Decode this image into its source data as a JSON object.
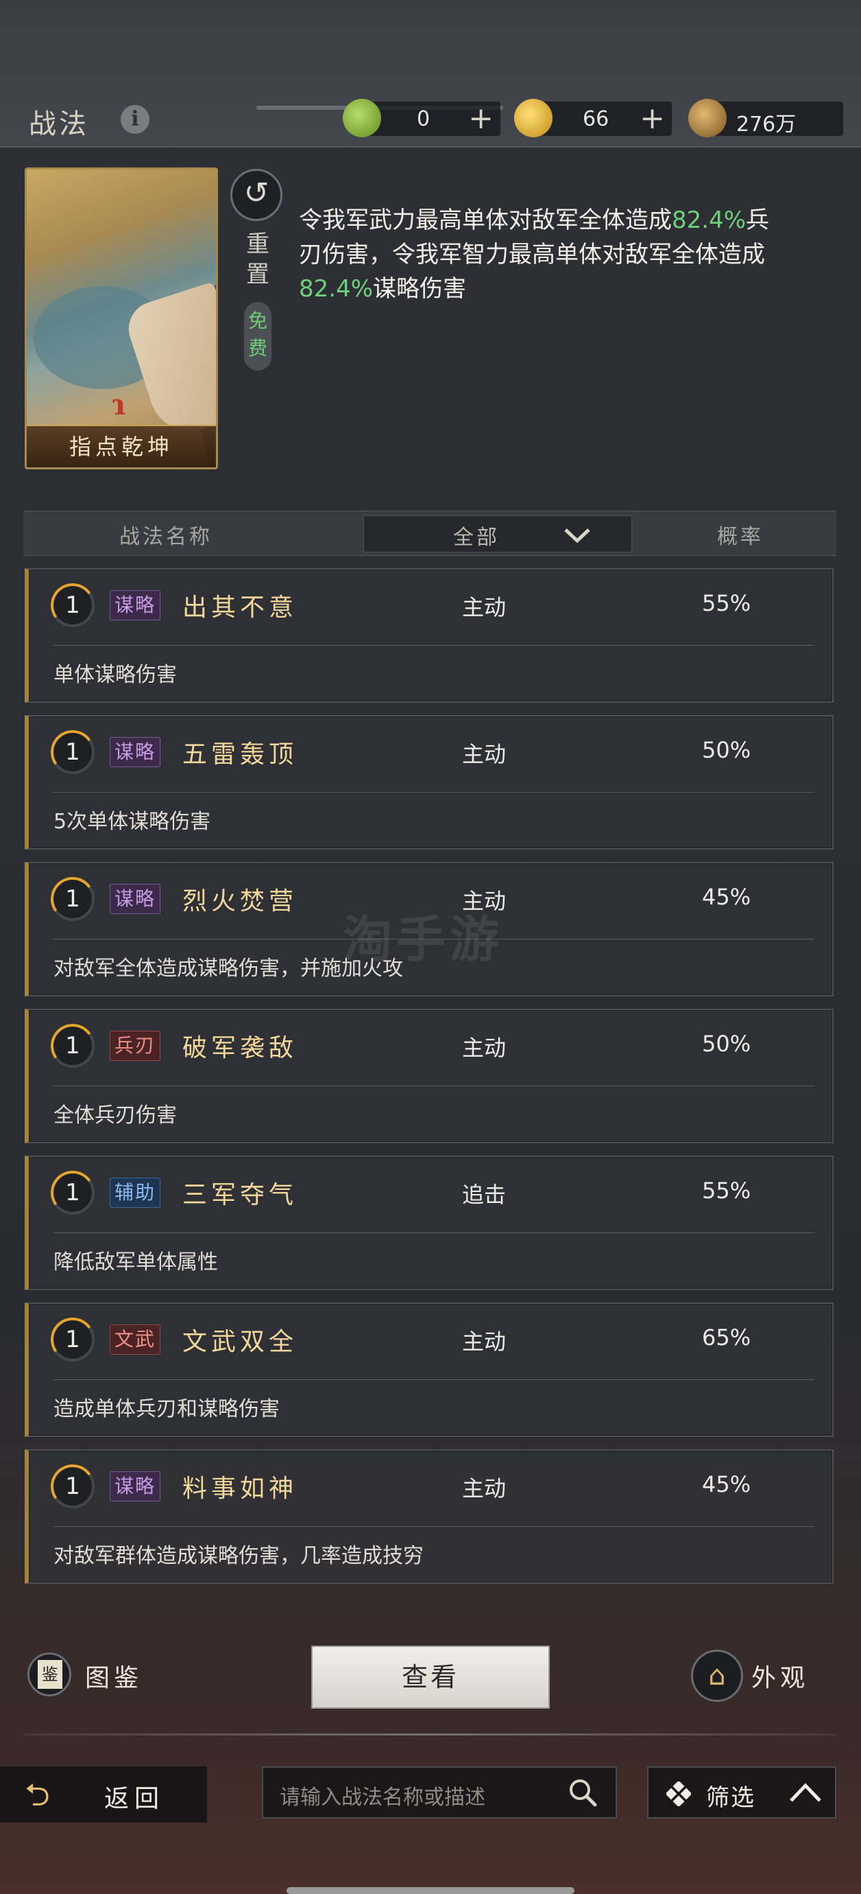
{
  "header": {
    "title": "战法",
    "currencies": [
      {
        "name": "jade-coin",
        "value": "0",
        "color": "#7fae3a"
      },
      {
        "name": "gold-coin",
        "value": "66",
        "color": "#e0b028"
      },
      {
        "name": "copper-coin",
        "value": "276万",
        "color": "#b88a3a"
      }
    ]
  },
  "tactic_card": {
    "name": "指点乾坤",
    "reset_label": "重置",
    "free_label": "免费",
    "desc_parts": [
      "令我军武力最高单体对敌军全体造成",
      "82.4%",
      "兵刃伤害，令我军智力最高单体对敌军全体造成",
      "82.4%",
      "谋略伤害"
    ]
  },
  "list_header": {
    "name_col": "战法名称",
    "filter_value": "全部",
    "rate_col": "概率"
  },
  "tactics": [
    {
      "level": "1",
      "type": "谋略",
      "type_class": "type-strat",
      "name": "出其不意",
      "mode": "主动",
      "rate": "55%",
      "desc": "单体谋略伤害"
    },
    {
      "level": "1",
      "type": "谋略",
      "type_class": "type-strat",
      "name": "五雷轰顶",
      "mode": "主动",
      "rate": "50%",
      "desc": "5次单体谋略伤害"
    },
    {
      "level": "1",
      "type": "谋略",
      "type_class": "type-strat",
      "name": "烈火焚营",
      "mode": "主动",
      "rate": "45%",
      "desc": "对敌军全体造成谋略伤害，并施加火攻"
    },
    {
      "level": "1",
      "type": "兵刃",
      "type_class": "type-blade",
      "name": "破军袭敌",
      "mode": "主动",
      "rate": "50%",
      "desc": "全体兵刃伤害"
    },
    {
      "level": "1",
      "type": "辅助",
      "type_class": "type-aid",
      "name": "三军夺气",
      "mode": "追击",
      "rate": "55%",
      "desc": "降低敌军单体属性"
    },
    {
      "level": "1",
      "type": "文武",
      "type_class": "type-wenwu",
      "name": "文武双全",
      "mode": "主动",
      "rate": "65%",
      "desc": "造成单体兵刃和谋略伤害"
    },
    {
      "level": "1",
      "type": "谋略",
      "type_class": "type-strat",
      "name": "料事如神",
      "mode": "主动",
      "rate": "45%",
      "desc": "对敌军群体造成谋略伤害，几率造成技穷"
    }
  ],
  "actions": {
    "codex_label": "图鉴",
    "view_label": "查看",
    "appearance_label": "外观"
  },
  "footer": {
    "back_label": "返回",
    "search_placeholder": "请输入战法名称或描述",
    "filter_label": "筛选"
  },
  "watermark": "淘手游"
}
